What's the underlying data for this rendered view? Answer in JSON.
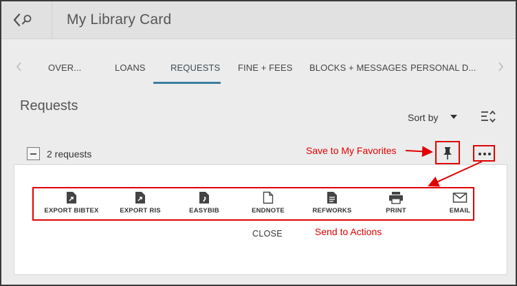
{
  "header": {
    "title": "My Library Card"
  },
  "tabs": [
    {
      "label": "OVER..."
    },
    {
      "label": "LOANS"
    },
    {
      "label": "REQUESTS"
    },
    {
      "label": "FINE + FEES"
    },
    {
      "label": "BLOCKS + MESSAGES"
    },
    {
      "label": "PERSONAL D..."
    }
  ],
  "active_tab": "REQUESTS",
  "section": {
    "title": "Requests",
    "sort_label": "Sort by",
    "count_label": "2 requests"
  },
  "annotations": {
    "favorites": "Save to My Favorites",
    "send": "Send to Actions"
  },
  "actions": [
    {
      "label": "EXPORT BIBTEX",
      "icon": "export-bibtex-icon"
    },
    {
      "label": "EXPORT RIS",
      "icon": "export-ris-icon"
    },
    {
      "label": "EASYBIB",
      "icon": "easybib-icon"
    },
    {
      "label": "ENDNOTE",
      "icon": "endnote-icon"
    },
    {
      "label": "REFWORKS",
      "icon": "refworks-icon"
    },
    {
      "label": "PRINT",
      "icon": "print-icon"
    },
    {
      "label": "EMAIL",
      "icon": "email-icon"
    }
  ],
  "close_label": "CLOSE",
  "colors": {
    "accent": "#3a7ea0",
    "annotation": "#e00000",
    "header_bg": "#e1e1e1",
    "page_bg": "#ececec"
  }
}
